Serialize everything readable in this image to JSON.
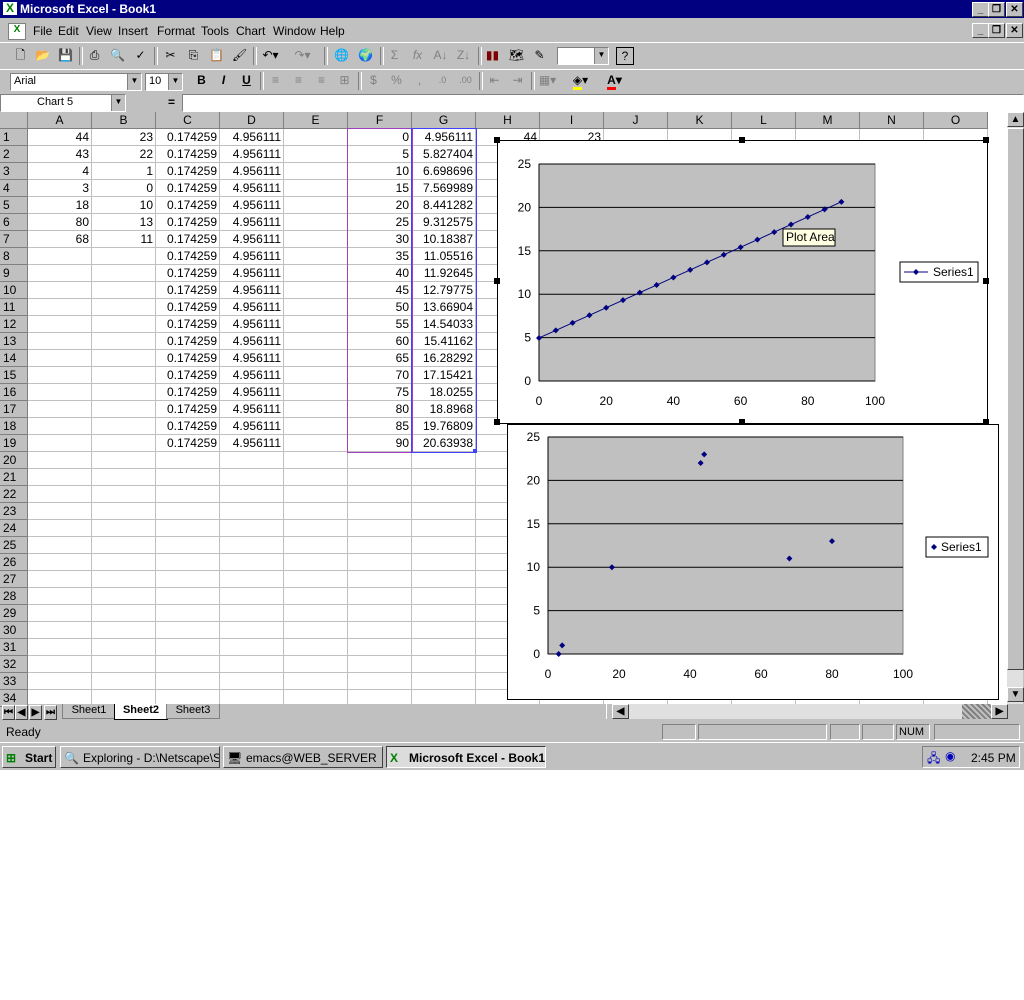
{
  "window": {
    "title": "Microsoft Excel - Book1"
  },
  "menu": [
    {
      "label": "File"
    },
    {
      "label": "Edit"
    },
    {
      "label": "View"
    },
    {
      "label": "Insert"
    },
    {
      "label": "Format"
    },
    {
      "label": "Tools"
    },
    {
      "label": "Chart"
    },
    {
      "label": "Window"
    },
    {
      "label": "Help"
    }
  ],
  "format": {
    "font": "Arial",
    "size": "10",
    "bold": "B",
    "italic": "I",
    "underline": "U"
  },
  "formula_bar": {
    "name_box": "Chart 5",
    "equals": "="
  },
  "columns": [
    "A",
    "B",
    "C",
    "D",
    "E",
    "F",
    "G",
    "H",
    "I",
    "J",
    "K",
    "L",
    "M",
    "N",
    "O"
  ],
  "rows": [
    "1",
    "2",
    "3",
    "4",
    "5",
    "6",
    "7",
    "8",
    "9",
    "10",
    "11",
    "12",
    "13",
    "14",
    "15",
    "16",
    "17",
    "18",
    "19",
    "20",
    "21",
    "22",
    "23",
    "24",
    "25",
    "26",
    "27",
    "28",
    "29",
    "30",
    "31",
    "32",
    "33",
    "34"
  ],
  "cells": {
    "A": [
      "44",
      "43",
      "4",
      "3",
      "18",
      "80",
      "68"
    ],
    "B": [
      "23",
      "22",
      "1",
      "0",
      "10",
      "13",
      "11"
    ],
    "C": [
      "0.174259",
      "0.174259",
      "0.174259",
      "0.174259",
      "0.174259",
      "0.174259",
      "0.174259",
      "0.174259",
      "0.174259",
      "0.174259",
      "0.174259",
      "0.174259",
      "0.174259",
      "0.174259",
      "0.174259",
      "0.174259",
      "0.174259",
      "0.174259",
      "0.174259"
    ],
    "D": [
      "4.956111",
      "4.956111",
      "4.956111",
      "4.956111",
      "4.956111",
      "4.956111",
      "4.956111",
      "4.956111",
      "4.956111",
      "4.956111",
      "4.956111",
      "4.956111",
      "4.956111",
      "4.956111",
      "4.956111",
      "4.956111",
      "4.956111",
      "4.956111",
      "4.956111"
    ],
    "F": [
      "0",
      "5",
      "10",
      "15",
      "20",
      "25",
      "30",
      "35",
      "40",
      "45",
      "50",
      "55",
      "60",
      "65",
      "70",
      "75",
      "80",
      "85",
      "90"
    ],
    "G": [
      "4.956111",
      "5.827404",
      "6.698696",
      "7.569989",
      "8.441282",
      "9.312575",
      "10.18387",
      "11.05516",
      "11.92645",
      "12.79775",
      "13.66904",
      "14.54033",
      "15.41162",
      "16.28292",
      "17.15421",
      "18.0255",
      "18.8968",
      "19.76809",
      "20.63938"
    ],
    "H1": "44",
    "I1": "23"
  },
  "sheet_tabs": [
    "Sheet1",
    "Sheet2",
    "Sheet3"
  ],
  "active_sheet": "Sheet2",
  "status": {
    "text": "Ready",
    "num": "NUM"
  },
  "taskbar": {
    "start": "Start",
    "items": [
      "Exploring - D:\\Netscape\\S...",
      "emacs@WEB_SERVER",
      "Microsoft Excel - Book1"
    ],
    "clock": "2:45 PM"
  },
  "chart_data": [
    {
      "type": "line",
      "series": [
        {
          "name": "Series1",
          "x": [
            0,
            5,
            10,
            15,
            20,
            25,
            30,
            35,
            40,
            45,
            50,
            55,
            60,
            65,
            70,
            75,
            80,
            85,
            90
          ],
          "y": [
            4.956111,
            5.827404,
            6.698696,
            7.569989,
            8.441282,
            9.312575,
            10.18387,
            11.05516,
            11.92645,
            12.79775,
            13.66904,
            14.54033,
            15.41162,
            16.28292,
            17.15421,
            18.0255,
            18.8968,
            19.76809,
            20.63938
          ]
        }
      ],
      "xlim": [
        0,
        100
      ],
      "ylim": [
        0,
        25
      ],
      "xticks": [
        0,
        20,
        40,
        60,
        80,
        100
      ],
      "yticks": [
        0,
        5,
        10,
        15,
        20,
        25
      ],
      "grid": "horizontal",
      "legend": "right",
      "tooltip": "Plot Area",
      "color": "#000080"
    },
    {
      "type": "scatter",
      "series": [
        {
          "name": "Series1",
          "x": [
            44,
            43,
            4,
            3,
            18,
            80,
            68
          ],
          "y": [
            23,
            22,
            1,
            0,
            10,
            13,
            11
          ]
        }
      ],
      "xlim": [
        0,
        100
      ],
      "ylim": [
        0,
        25
      ],
      "xticks": [
        0,
        20,
        40,
        60,
        80,
        100
      ],
      "yticks": [
        0,
        5,
        10,
        15,
        20,
        25
      ],
      "grid": "horizontal",
      "legend": "right",
      "color": "#000080"
    }
  ]
}
